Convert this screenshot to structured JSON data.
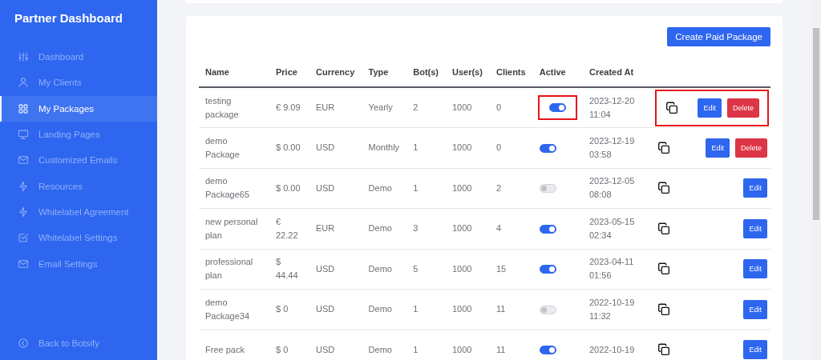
{
  "sidebar": {
    "title": "Partner Dashboard",
    "items": [
      {
        "label": "Dashboard",
        "selected": false
      },
      {
        "label": "My Clients",
        "selected": false
      },
      {
        "label": "My Packages",
        "selected": true
      },
      {
        "label": "Landing Pages",
        "selected": false
      },
      {
        "label": "Customized Emails",
        "selected": false
      },
      {
        "label": "Resources",
        "selected": false
      },
      {
        "label": "Whitelabel Agreement",
        "selected": false
      },
      {
        "label": "Whitelabel Settings",
        "selected": false
      },
      {
        "label": "Email Settings",
        "selected": false
      }
    ],
    "footer": {
      "label": "Back to Botsify"
    }
  },
  "create_button": "Create Paid Package",
  "table": {
    "columns": [
      "Name",
      "Price",
      "Currency",
      "Type",
      "Bot(s)",
      "User(s)",
      "Clients",
      "Active",
      "Created At"
    ],
    "rows": [
      {
        "cells": [
          "testing package",
          "€ 9.09",
          "EUR",
          "Yearly",
          "2",
          "1000",
          "0"
        ],
        "active": true,
        "created": "2023-12-20 11:04",
        "edit": "Edit",
        "delete": "Delete",
        "highlighted": true
      },
      {
        "cells": [
          "demo Package",
          "$ 0.00",
          "USD",
          "Monthly",
          "1",
          "1000",
          "0"
        ],
        "active": true,
        "created": "2023-12-19 03:58",
        "edit": "Edit",
        "delete": "Delete",
        "highlighted": false
      },
      {
        "cells": [
          "demo Package65",
          "$ 0.00",
          "USD",
          "Demo",
          "1",
          "1000",
          "2"
        ],
        "active": false,
        "created": "2023-12-05 08:08",
        "edit": "Edit",
        "highlighted": false
      },
      {
        "cells": [
          "new personal plan",
          "€ 22.22",
          "EUR",
          "Demo",
          "3",
          "1000",
          "4"
        ],
        "active": true,
        "created": "2023-05-15 02:34",
        "edit": "Edit",
        "highlighted": false
      },
      {
        "cells": [
          "professional plan",
          "$ 44.44",
          "USD",
          "Demo",
          "5",
          "1000",
          "15"
        ],
        "active": true,
        "created": "2023-04-11 01:56",
        "edit": "Edit",
        "highlighted": false
      },
      {
        "cells": [
          "demo Package34",
          "$ 0",
          "USD",
          "Demo",
          "1",
          "1000",
          "11"
        ],
        "active": false,
        "created": "2022-10-19 11:32",
        "edit": "Edit",
        "highlighted": false
      },
      {
        "cells": [
          "Free pack",
          "$ 0",
          "USD",
          "Demo",
          "1",
          "1000",
          "11"
        ],
        "active": true,
        "created": "2022-10-19",
        "edit": "Edit",
        "highlighted": false
      }
    ]
  }
}
